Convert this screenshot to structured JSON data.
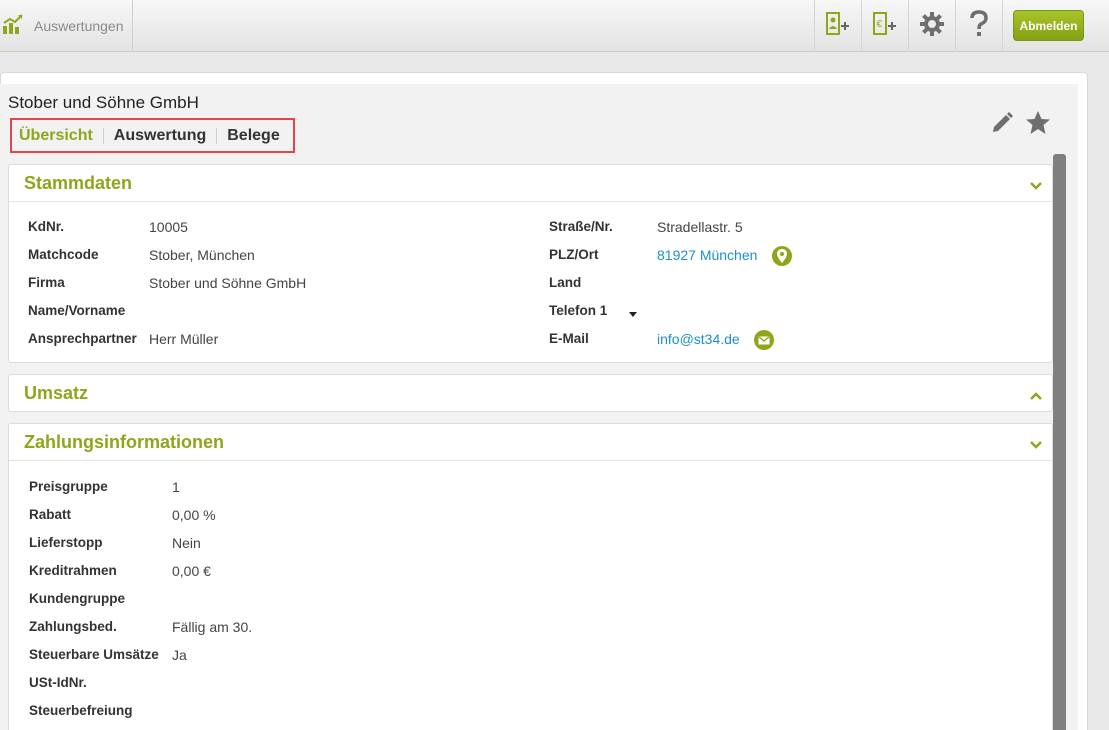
{
  "topbar": {
    "section_label": "Auswertungen",
    "logout_label": "Abmelden",
    "icons": [
      "chart-icon",
      "add-contact-icon",
      "add-document-icon",
      "gear-icon",
      "help-icon"
    ]
  },
  "header": {
    "company_name": "Stober und Söhne GmbH",
    "tabs": [
      {
        "label": "Übersicht",
        "active": true
      },
      {
        "label": "Auswertung",
        "active": false
      },
      {
        "label": "Belege",
        "active": false
      }
    ]
  },
  "stammdaten": {
    "title": "Stammdaten",
    "left": [
      {
        "label": "KdNr.",
        "value": "10005"
      },
      {
        "label": "Matchcode",
        "value": "Stober, München"
      },
      {
        "label": "Firma",
        "value": "Stober und Söhne GmbH"
      },
      {
        "label": "Name/Vorname",
        "value": ""
      },
      {
        "label": "Ansprechpartner",
        "value": "Herr Müller"
      }
    ],
    "right": [
      {
        "label": "Straße/Nr.",
        "value": "Stradellastr. 5"
      },
      {
        "label": "PLZ/Ort",
        "value": "81927 München"
      },
      {
        "label": "Land",
        "value": ""
      },
      {
        "label": "Telefon 1",
        "value": ""
      },
      {
        "label": "E-Mail",
        "value": "info@st34.de"
      }
    ]
  },
  "umsatz": {
    "title": "Umsatz"
  },
  "zahlung": {
    "title": "Zahlungsinformationen",
    "rows": [
      {
        "label": "Preisgruppe",
        "value": "1"
      },
      {
        "label": "Rabatt",
        "value": "0,00 %"
      },
      {
        "label": "Lieferstopp",
        "value": "Nein"
      },
      {
        "label": "Kreditrahmen",
        "value": "0,00 €"
      },
      {
        "label": "Kundengruppe",
        "value": ""
      },
      {
        "label": "Zahlungsbed.",
        "value": "Fällig am 30."
      },
      {
        "label": "Steuerbare Umsätze",
        "value": "Ja"
      },
      {
        "label": "USt-IdNr.",
        "value": ""
      },
      {
        "label": "Steuerbefreiung",
        "value": ""
      }
    ]
  },
  "colors": {
    "accent": "#8ea61b",
    "link": "#1e8fc8",
    "highlight": "#e0454f"
  }
}
